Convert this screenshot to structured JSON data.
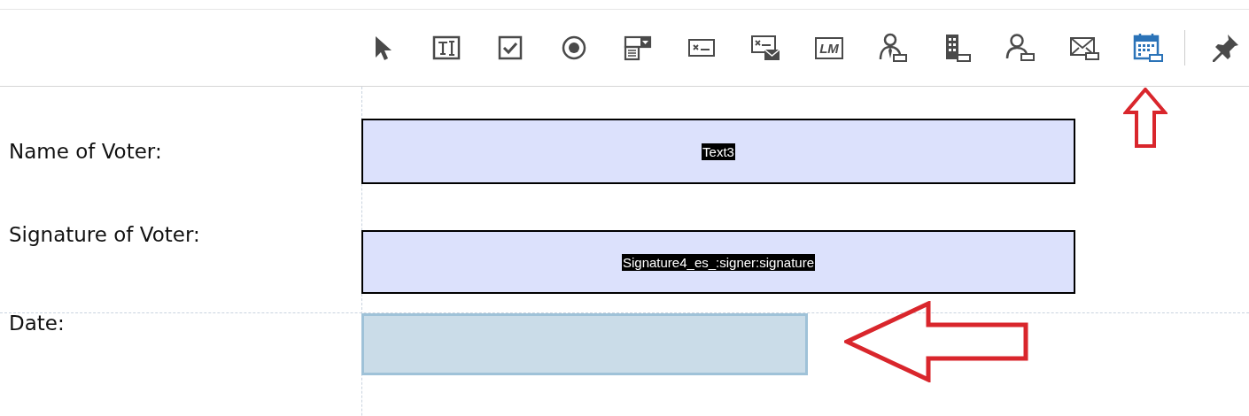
{
  "toolbar": {
    "tools": [
      {
        "kind": "pointer",
        "selected": false
      },
      {
        "kind": "text-field",
        "selected": false
      },
      {
        "kind": "checkbox",
        "selected": false
      },
      {
        "kind": "radio",
        "selected": false
      },
      {
        "kind": "dropdown",
        "selected": false
      },
      {
        "kind": "input",
        "selected": false
      },
      {
        "kind": "email-input",
        "selected": false
      },
      {
        "kind": "label",
        "label": "LM",
        "selected": false
      },
      {
        "kind": "signer",
        "selected": false
      },
      {
        "kind": "company",
        "selected": false
      },
      {
        "kind": "person",
        "selected": false
      },
      {
        "kind": "envelope",
        "selected": false
      },
      {
        "kind": "calendar",
        "selected": true
      }
    ],
    "pinned": true
  },
  "form": {
    "rows": [
      {
        "label": "Name of Voter:",
        "field": {
          "kind": "text",
          "name": "Text3"
        }
      },
      {
        "label": "Signature of Voter:",
        "field": {
          "kind": "signature",
          "name": "Signature4_es_:signer:signature"
        }
      },
      {
        "label": "Date:",
        "field": {
          "kind": "date"
        }
      }
    ]
  }
}
